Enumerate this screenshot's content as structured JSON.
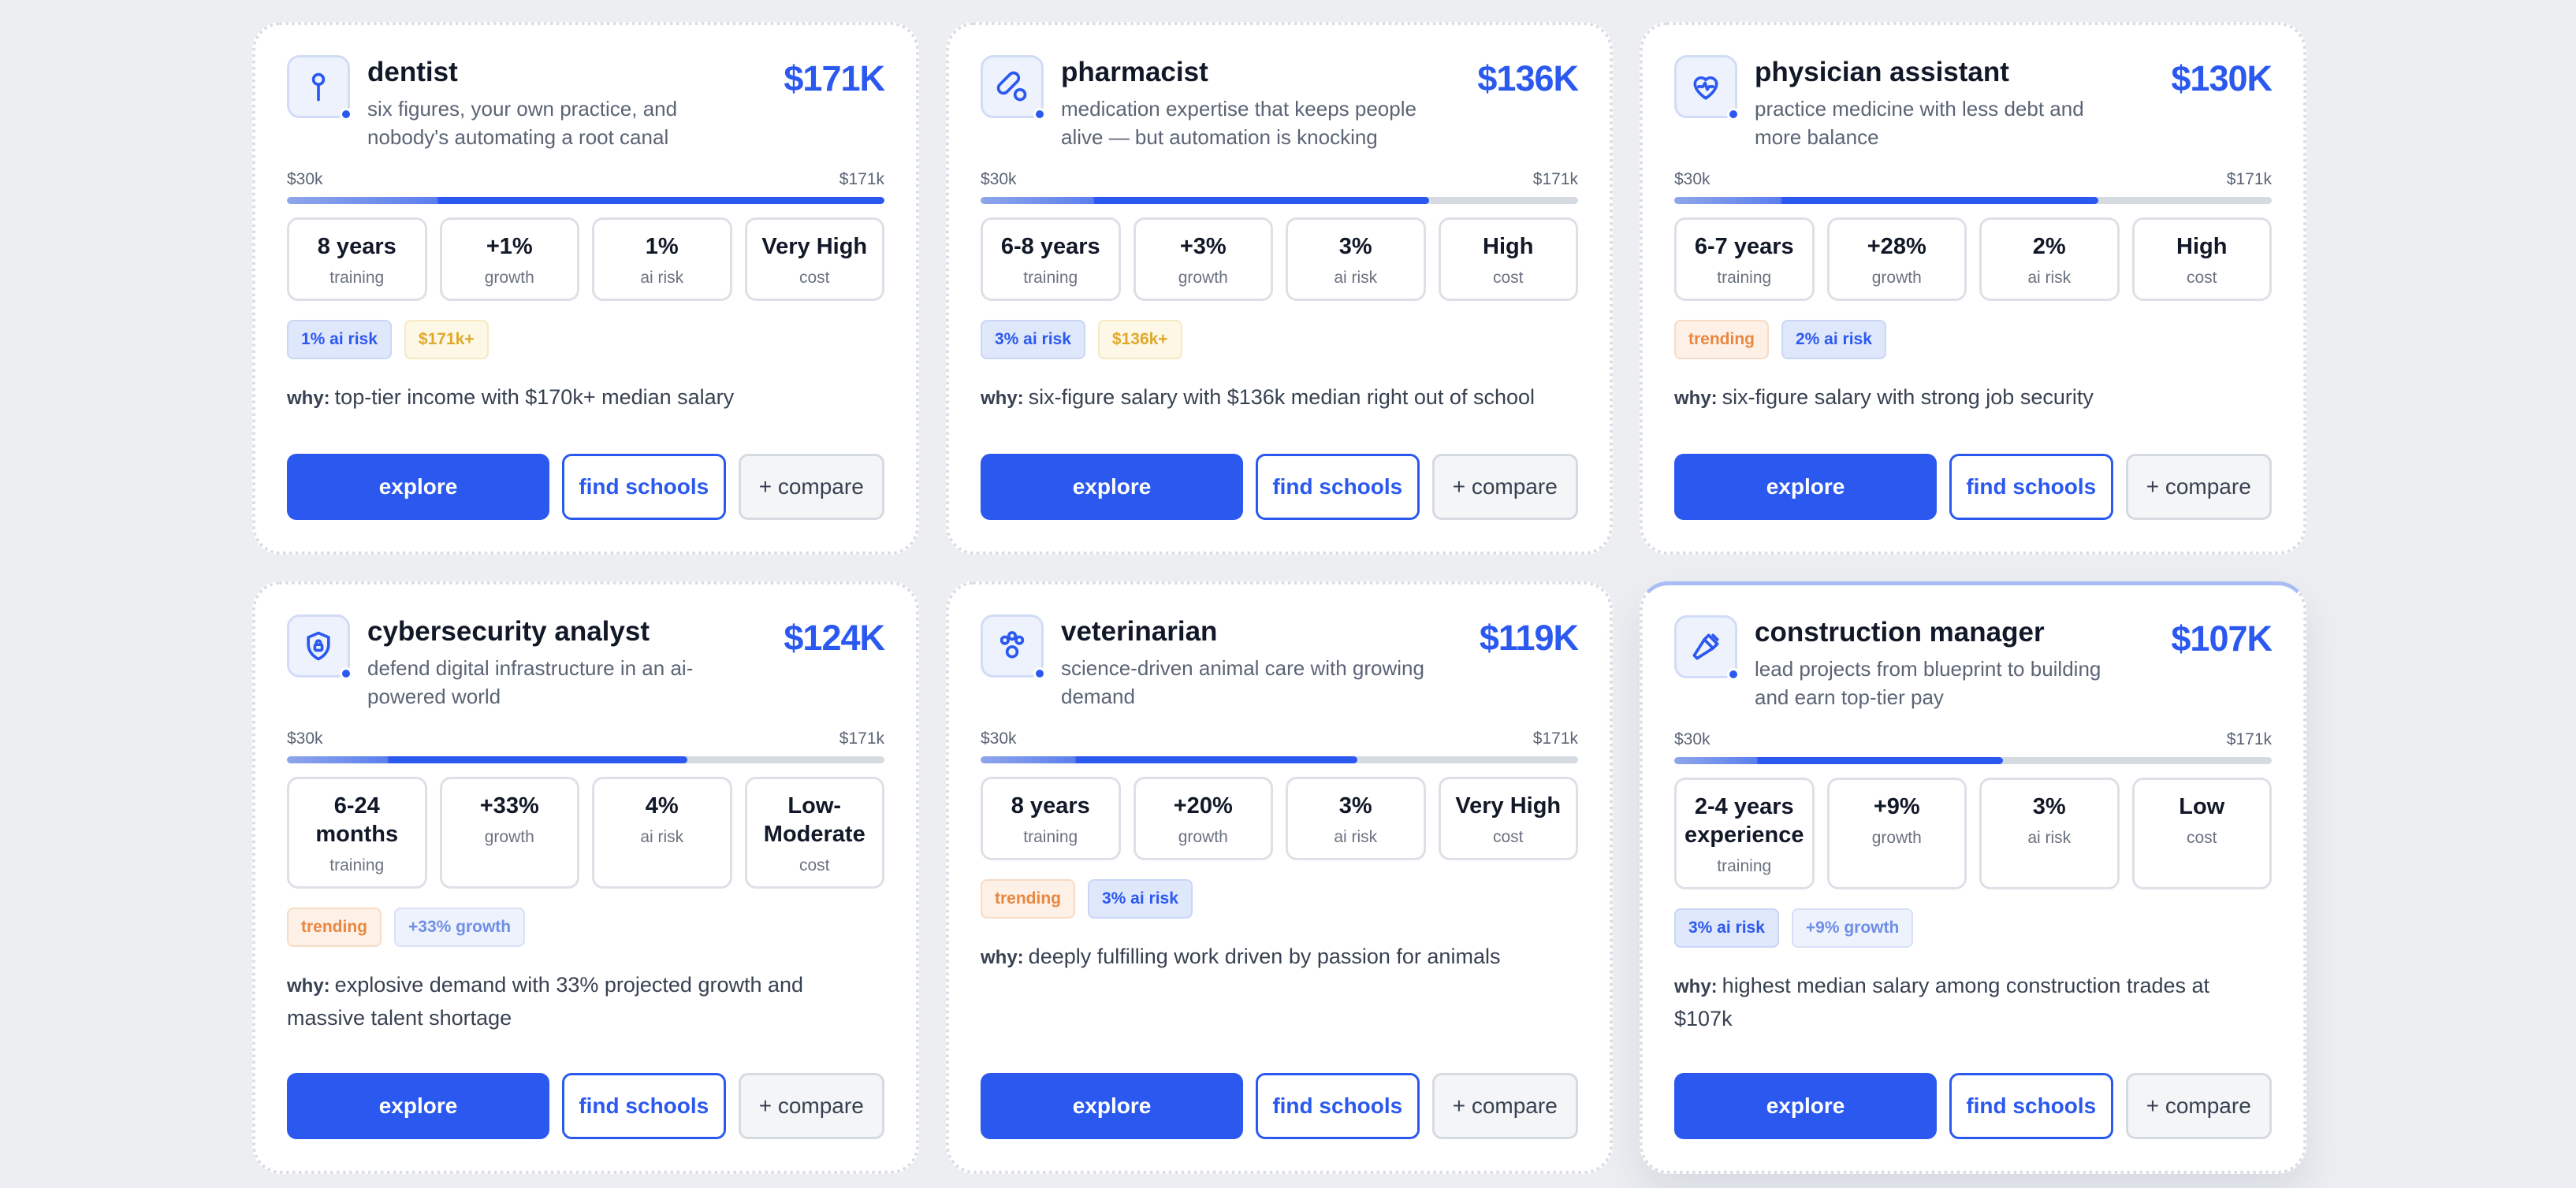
{
  "range": {
    "min_label": "$30k",
    "max_label": "$171k"
  },
  "why_label": "why:",
  "buttons": {
    "explore": "explore",
    "find_schools": "find schools",
    "compare": "+ compare"
  },
  "cards": [
    {
      "icon": "dental-tool-icon",
      "title": "dentist",
      "subtitle": "six figures, your own practice, and nobody's automating a root canal",
      "salary": "$171K",
      "salary_fraction": 1.0,
      "stats": [
        {
          "value": "8 years",
          "label": "training"
        },
        {
          "value": "+1%",
          "label": "growth"
        },
        {
          "value": "1%",
          "label": "ai risk"
        },
        {
          "value": "Very High",
          "label": "cost"
        }
      ],
      "tags": [
        {
          "text": "1% ai risk",
          "style": "blue"
        },
        {
          "text": "$171k+",
          "style": "gold"
        }
      ],
      "why": "top-tier income with $170k+ median salary"
    },
    {
      "icon": "pill-bottle-icon",
      "title": "pharmacist",
      "subtitle": "medication expertise that keeps people alive — but automation is knocking",
      "salary": "$136K",
      "salary_fraction": 0.75,
      "stats": [
        {
          "value": "6-8 years",
          "label": "training"
        },
        {
          "value": "+3%",
          "label": "growth"
        },
        {
          "value": "3%",
          "label": "ai risk"
        },
        {
          "value": "High",
          "label": "cost"
        }
      ],
      "tags": [
        {
          "text": "3% ai risk",
          "style": "blue"
        },
        {
          "text": "$136k+",
          "style": "gold"
        }
      ],
      "why": "six-figure salary with $136k median right out of school"
    },
    {
      "icon": "heart-pulse-icon",
      "title": "physician assistant",
      "subtitle": "practice medicine with less debt and more balance",
      "salary": "$130K",
      "salary_fraction": 0.71,
      "stats": [
        {
          "value": "6-7 years",
          "label": "training"
        },
        {
          "value": "+28%",
          "label": "growth"
        },
        {
          "value": "2%",
          "label": "ai risk"
        },
        {
          "value": "High",
          "label": "cost"
        }
      ],
      "tags": [
        {
          "text": "trending",
          "style": "orange"
        },
        {
          "text": "2% ai risk",
          "style": "blue"
        }
      ],
      "why": "six-figure salary with strong job security"
    },
    {
      "icon": "shield-lock-icon",
      "title": "cybersecurity analyst",
      "subtitle": "defend digital infrastructure in an ai-powered world",
      "salary": "$124K",
      "salary_fraction": 0.67,
      "stats": [
        {
          "value": "6-24 months",
          "label": "training"
        },
        {
          "value": "+33%",
          "label": "growth"
        },
        {
          "value": "4%",
          "label": "ai risk"
        },
        {
          "value": "Low-Moderate",
          "label": "cost"
        }
      ],
      "tags": [
        {
          "text": "trending",
          "style": "orange"
        },
        {
          "text": "+33% growth",
          "style": "lightblue"
        }
      ],
      "why": "explosive demand with 33% projected growth and massive talent shortage"
    },
    {
      "icon": "paw-icon",
      "title": "veterinarian",
      "subtitle": "science-driven animal care with growing demand",
      "salary": "$119K",
      "salary_fraction": 0.63,
      "stats": [
        {
          "value": "8 years",
          "label": "training"
        },
        {
          "value": "+20%",
          "label": "growth"
        },
        {
          "value": "3%",
          "label": "ai risk"
        },
        {
          "value": "Very High",
          "label": "cost"
        }
      ],
      "tags": [
        {
          "text": "trending",
          "style": "orange"
        },
        {
          "text": "3% ai risk",
          "style": "blue"
        }
      ],
      "why": "deeply fulfilling work driven by passion for animals"
    },
    {
      "icon": "hammer-icon",
      "title": "construction manager",
      "subtitle": "lead projects from blueprint to building and earn top-tier pay",
      "salary": "$107K",
      "salary_fraction": 0.55,
      "stats": [
        {
          "value": "2-4 years experience",
          "label": "training"
        },
        {
          "value": "+9%",
          "label": "growth"
        },
        {
          "value": "3%",
          "label": "ai risk"
        },
        {
          "value": "Low",
          "label": "cost"
        }
      ],
      "tags": [
        {
          "text": "3% ai risk",
          "style": "blue"
        },
        {
          "text": "+9% growth",
          "style": "lightblue"
        }
      ],
      "why": "highest median salary among construction trades at $107k"
    }
  ]
}
